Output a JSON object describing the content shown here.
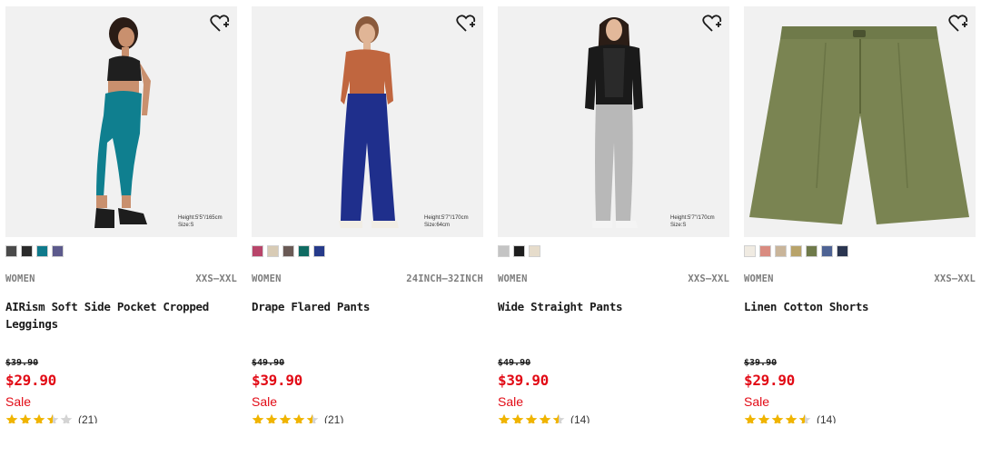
{
  "products": [
    {
      "category": "WOMEN",
      "size_range": "XXS–XXL",
      "name": "AIRism Soft Side Pocket Cropped Leggings",
      "original_price": "$39.90",
      "price": "$29.90",
      "sale_label": "Sale",
      "rating": 3.5,
      "review_count": "(21)",
      "model_height": "Height:5'5\"/165cm",
      "model_size": "Size:S",
      "swatches": [
        "#4a4a4a",
        "#2b2b2b",
        "#0f7a8c",
        "#5c5a8c"
      ]
    },
    {
      "category": "WOMEN",
      "size_range": "24INCH–32INCH",
      "name": "Drape Flared Pants",
      "original_price": "$49.90",
      "price": "$39.90",
      "sale_label": "Sale",
      "rating": 4.5,
      "review_count": "(21)",
      "model_height": "Height:5'7\"/170cm",
      "model_size": "Size:64cm",
      "swatches": [
        "#b8456a",
        "#d8cbb5",
        "#6a5a55",
        "#0f6b62",
        "#263a8a"
      ]
    },
    {
      "category": "WOMEN",
      "size_range": "XXS–XXL",
      "name": "Wide Straight Pants",
      "original_price": "$49.90",
      "price": "$39.90",
      "sale_label": "Sale",
      "rating": 4.5,
      "review_count": "(14)",
      "model_height": "Height:5'7\"/170cm",
      "model_size": "Size:S",
      "swatches": [
        "#c4c4c4",
        "#1e1e1e",
        "#e6dccb"
      ]
    },
    {
      "category": "WOMEN",
      "size_range": "XXS–XXL",
      "name": "Linen Cotton Shorts",
      "original_price": "$39.90",
      "price": "$29.90",
      "sale_label": "Sale",
      "rating": 4.5,
      "review_count": "(14)",
      "swatches": [
        "#f0ebe2",
        "#d98b80",
        "#c9b59a",
        "#b8a36a",
        "#6f7a4a",
        "#4e6394",
        "#2a3550"
      ]
    }
  ],
  "colors": {
    "sale_red": "#e20b16",
    "star_gold": "#f0b400",
    "star_empty": "#d4d4d4",
    "meta_gray": "#7d7d7d"
  },
  "icons": {
    "favorite": "heart-plus-icon",
    "star": "star-icon"
  }
}
